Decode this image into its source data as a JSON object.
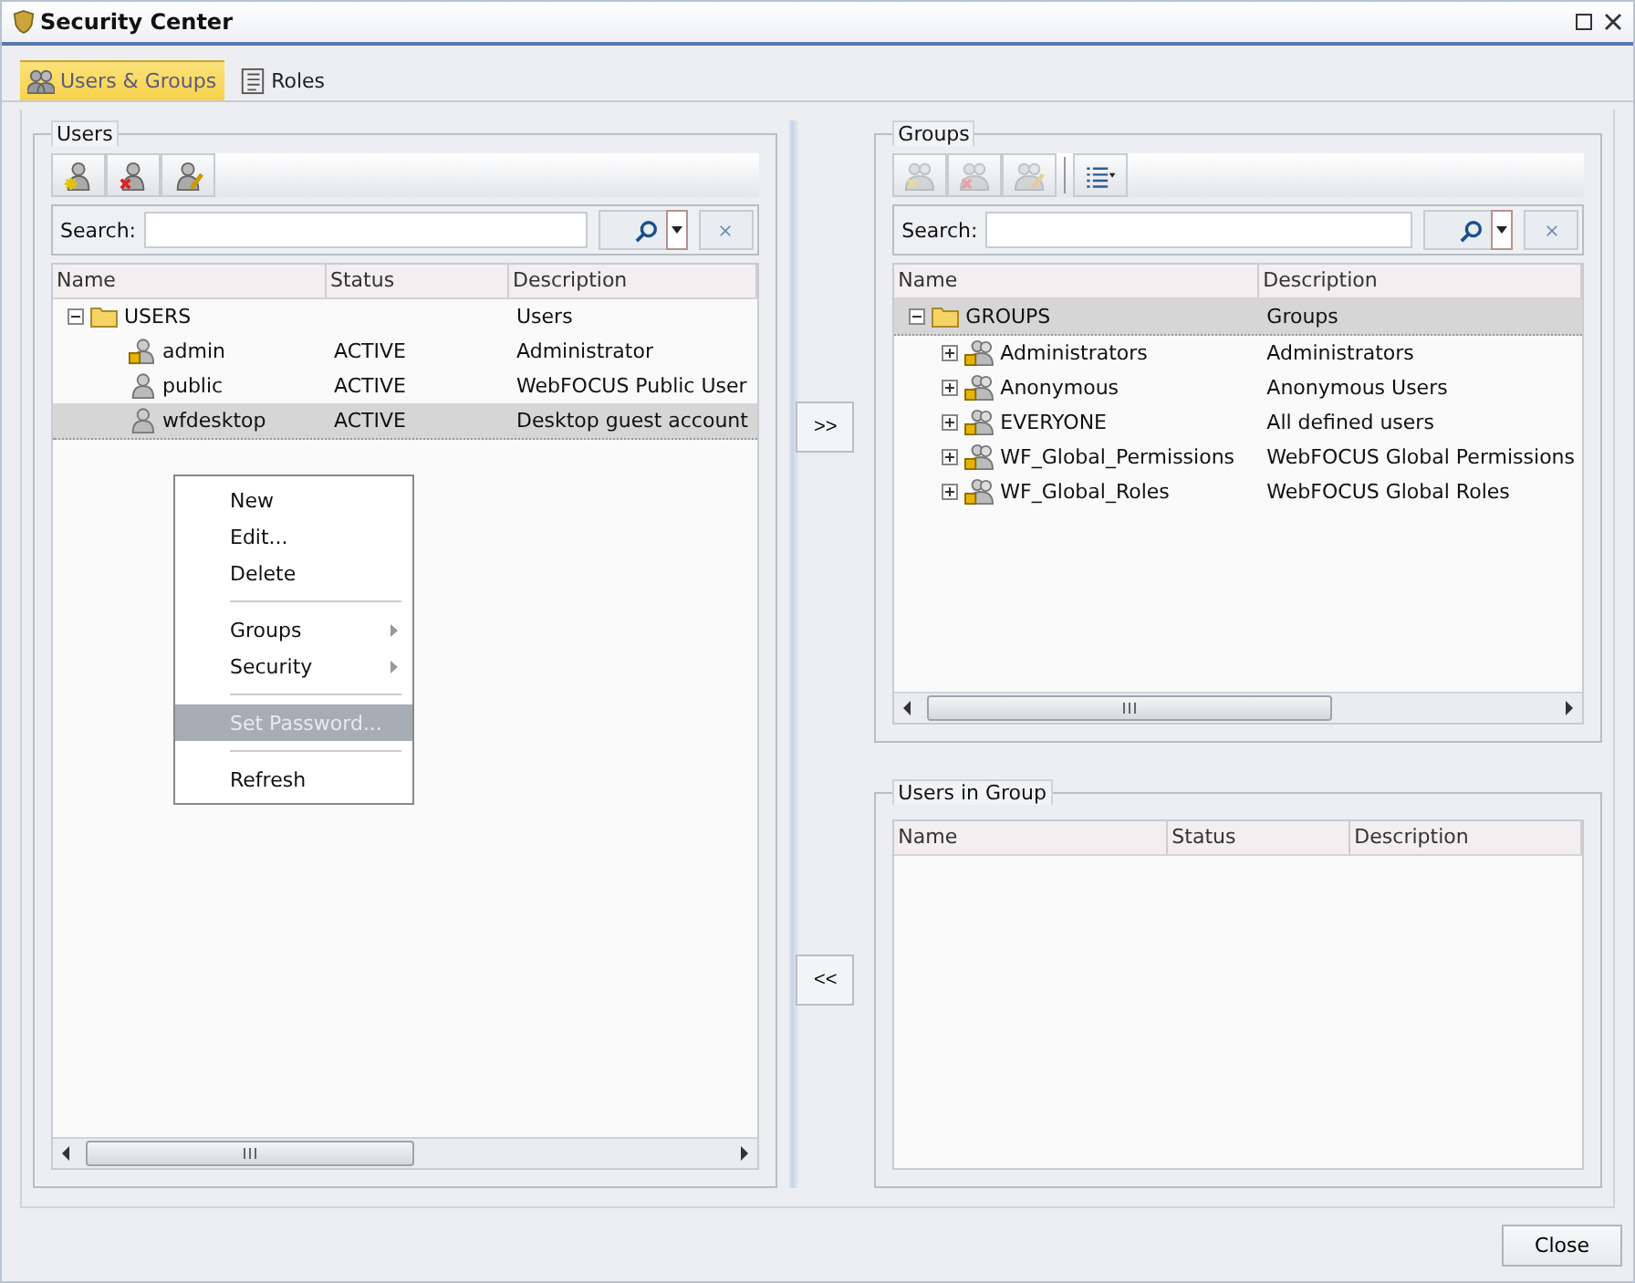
{
  "window": {
    "title": "Security Center"
  },
  "tabs": [
    {
      "label": "Users & Groups",
      "selected": true,
      "kind": "users"
    },
    {
      "label": "Roles",
      "selected": false,
      "kind": "roles"
    }
  ],
  "users_panel": {
    "title": "Users",
    "toolbar": [
      {
        "kind": "new",
        "disabled": false
      },
      {
        "kind": "delete",
        "disabled": false
      },
      {
        "kind": "edit",
        "disabled": false
      }
    ],
    "search": {
      "label": "Search:"
    },
    "columns": [
      "Name",
      "Status",
      "Description"
    ],
    "tree": {
      "name": "USERS",
      "description": "Users",
      "expanded": true,
      "selected": false,
      "children": [
        {
          "name": "admin",
          "status": "ACTIVE",
          "description": "Administrator",
          "locked": true,
          "selected": false
        },
        {
          "name": "public",
          "status": "ACTIVE",
          "description": "WebFOCUS Public User",
          "locked": false,
          "selected": false
        },
        {
          "name": "wfdesktop",
          "status": "ACTIVE",
          "description": "Desktop guest account",
          "locked": false,
          "selected": true
        }
      ]
    }
  },
  "context_menu": [
    {
      "kind": "item",
      "label": "New",
      "submenu": false,
      "selected": false
    },
    {
      "kind": "item",
      "label": "Edit...",
      "submenu": false,
      "selected": false
    },
    {
      "kind": "item",
      "label": "Delete",
      "submenu": false,
      "selected": false
    },
    {
      "kind": "separator"
    },
    {
      "kind": "item",
      "label": "Groups",
      "submenu": true,
      "selected": false
    },
    {
      "kind": "item",
      "label": "Security",
      "submenu": true,
      "selected": false
    },
    {
      "kind": "separator"
    },
    {
      "kind": "item",
      "label": "Set Password...",
      "submenu": false,
      "selected": true
    },
    {
      "kind": "separator"
    },
    {
      "kind": "item",
      "label": "Refresh",
      "submenu": false,
      "selected": false
    }
  ],
  "add_button": ">>",
  "remove_button": "<<",
  "groups_panel": {
    "title": "Groups",
    "toolbar": [
      {
        "kind": "new",
        "disabled": true
      },
      {
        "kind": "delete",
        "disabled": true
      },
      {
        "kind": "edit",
        "disabled": true
      },
      {
        "kind": "list",
        "disabled": false
      }
    ],
    "search": {
      "label": "Search:"
    },
    "columns": [
      "Name",
      "Description"
    ],
    "tree": {
      "name": "GROUPS",
      "description": "Groups",
      "expanded": true,
      "selected": true,
      "children": [
        {
          "name": "Administrators",
          "description": "Administrators",
          "expanded": false
        },
        {
          "name": "Anonymous",
          "description": "Anonymous Users",
          "expanded": false
        },
        {
          "name": "EVERYONE",
          "description": "All defined users",
          "expanded": false
        },
        {
          "name": "WF_Global_Permissions",
          "description": "WebFOCUS Global Permissions",
          "expanded": false
        },
        {
          "name": "WF_Global_Roles",
          "description": "WebFOCUS Global Roles",
          "expanded": false
        }
      ]
    }
  },
  "members_panel": {
    "title": "Users in Group",
    "columns": [
      "Name",
      "Status",
      "Description"
    ]
  },
  "close_button": "Close"
}
